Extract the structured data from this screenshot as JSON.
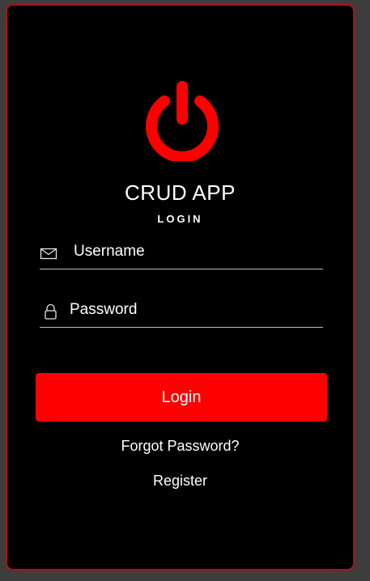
{
  "app": {
    "title": "CRUD APP",
    "subtitle": "LOGIN",
    "accent_color": "#ff0000",
    "logo_icon": "power-icon"
  },
  "form": {
    "username": {
      "placeholder": "Username",
      "value": "",
      "icon": "envelope-icon"
    },
    "password": {
      "placeholder": "Password",
      "value": "",
      "icon": "lock-icon"
    },
    "login_label": "Login"
  },
  "links": {
    "forgot": "Forgot Password?",
    "register": "Register"
  }
}
